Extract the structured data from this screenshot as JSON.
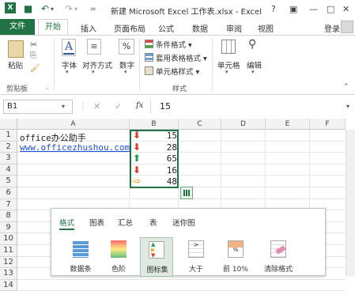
{
  "titlebar": {
    "title": "新建 Microsoft Excel 工作表.xlsx - Excel",
    "help": "?",
    "min": "—",
    "max": "□",
    "close": "✕"
  },
  "ribbon_tabs": {
    "file": "文件",
    "home": "开始",
    "insert": "插入",
    "layout": "页面布局",
    "formulas": "公式",
    "data": "数据",
    "review": "审阅",
    "view": "视图",
    "login": "登录"
  },
  "ribbon": {
    "paste": "粘贴",
    "clipboard": "剪贴板",
    "font": "字体",
    "align": "对齐方式",
    "number": "数字",
    "cond_format": "条件格式",
    "table_format": "套用表格格式",
    "cell_style": "单元格样式",
    "styles": "样式",
    "cells": "单元格",
    "editing": "编辑"
  },
  "formula_bar": {
    "name_box": "B1",
    "fx": "fx",
    "value": "15",
    "cancel": "✕",
    "enter": "✓"
  },
  "columns": [
    "A",
    "B",
    "C",
    "D",
    "E",
    "F"
  ],
  "rows": [
    "1",
    "2",
    "3",
    "4",
    "5",
    "6",
    "7",
    "8",
    "9",
    "10",
    "11",
    "12",
    "13",
    "14"
  ],
  "cells": {
    "a1": "office办公助手",
    "a2": "www.officezhushou.com",
    "b": [
      "15",
      "28",
      "65",
      "16",
      "48"
    ]
  },
  "arrows": [
    {
      "dir": "down",
      "color": "#e03a2e"
    },
    {
      "dir": "down",
      "color": "#e03a2e"
    },
    {
      "dir": "up",
      "color": "#1f9e4a"
    },
    {
      "dir": "down",
      "color": "#e03a2e"
    },
    {
      "dir": "right",
      "color": "#f2a82c"
    }
  ],
  "quick_analysis": {
    "tabs": [
      "格式",
      "图表",
      "汇总",
      "表",
      "迷你图"
    ],
    "items": [
      "数据条",
      "色阶",
      "图标集",
      "大于",
      "前 10%",
      "清除格式"
    ]
  }
}
